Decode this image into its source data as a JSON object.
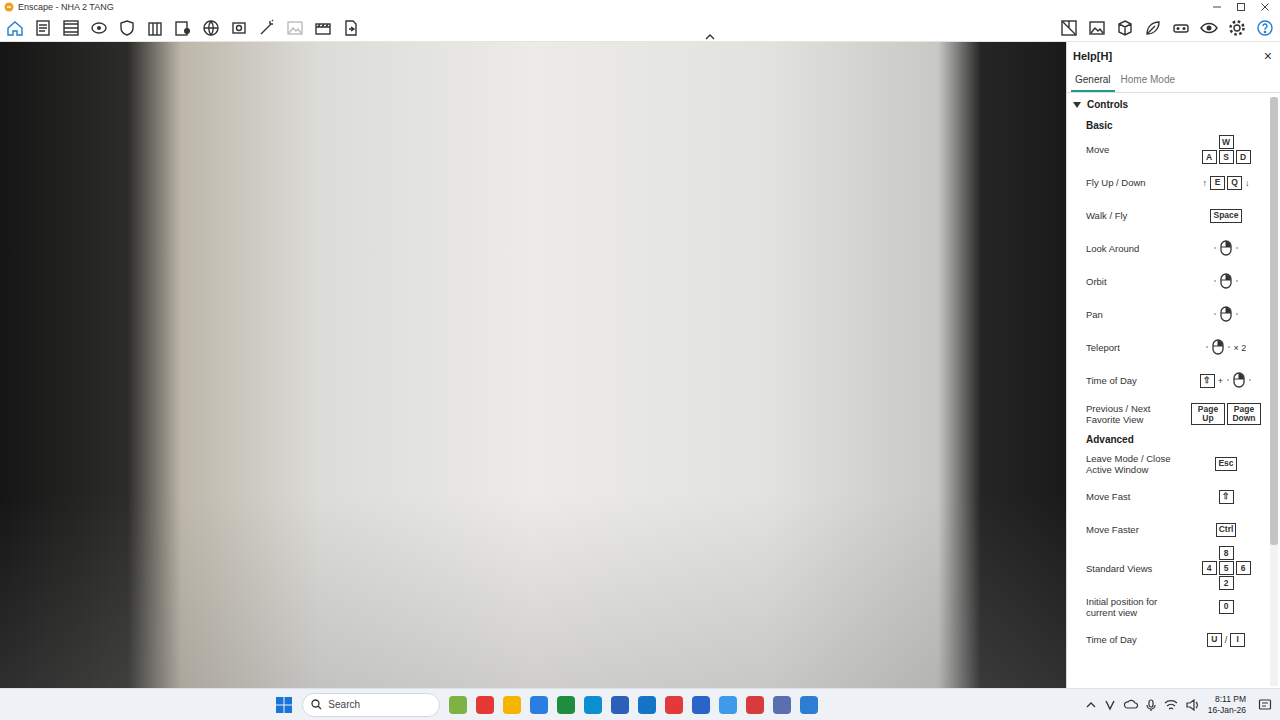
{
  "window": {
    "title": "Enscape - NHA 2 TANG"
  },
  "toolbar": {
    "left": [
      {
        "selected": true
      },
      {
        "selected": false
      },
      {
        "selected": false
      },
      {
        "selected": false
      },
      {
        "selected": false
      },
      {
        "selected": false
      },
      {
        "selected": false
      },
      {
        "selected": false
      },
      {
        "selected": false
      },
      {
        "selected": false
      },
      {
        "selected": false
      },
      {
        "selected": false
      },
      {
        "selected": false
      }
    ],
    "right": [
      {
        "selected": false
      },
      {
        "selected": false
      },
      {
        "selected": false
      },
      {
        "selected": false
      },
      {
        "selected": false
      },
      {
        "selected": false
      },
      {
        "selected": false
      },
      {
        "selected": true
      }
    ]
  },
  "help": {
    "title": "Help[H]",
    "close": "×",
    "tabs": [
      {
        "label": "General",
        "selected": true
      },
      {
        "label": "Home Mode",
        "selected": false
      }
    ],
    "section": {
      "label": "Controls",
      "expanded": true
    },
    "groups": [
      {
        "heading": "Basic",
        "rows": [
          {
            "label": "Move",
            "keys": [
              [
                {
                  "kind": "key",
                  "text": "W"
                }
              ],
              [
                {
                  "kind": "key",
                  "text": "A"
                },
                {
                  "kind": "key",
                  "text": "S"
                },
                {
                  "kind": "key",
                  "text": "D"
                }
              ]
            ]
          },
          {
            "label": "Fly Up / Down",
            "keys": [
              [
                {
                  "kind": "sep",
                  "text": "↑"
                },
                {
                  "kind": "key",
                  "text": "E"
                },
                {
                  "kind": "key",
                  "text": "Q"
                },
                {
                  "kind": "sep",
                  "text": "↓"
                }
              ]
            ]
          },
          {
            "label": "Walk / Fly",
            "keys": [
              [
                {
                  "kind": "key",
                  "text": "Space"
                }
              ]
            ]
          },
          {
            "label": "Look Around",
            "keys": [
              [
                {
                  "kind": "mouse"
                }
              ]
            ]
          },
          {
            "label": "Orbit",
            "keys": [
              [
                {
                  "kind": "mouse"
                }
              ]
            ]
          },
          {
            "label": "Pan",
            "keys": [
              [
                {
                  "kind": "mouse"
                }
              ]
            ]
          },
          {
            "label": "Teleport",
            "keys": [
              [
                {
                  "kind": "mouse"
                },
                {
                  "kind": "sep",
                  "text": "× 2"
                }
              ]
            ]
          },
          {
            "label": "Time of Day",
            "keys": [
              [
                {
                  "kind": "key",
                  "text": "⇧"
                },
                {
                  "kind": "sep",
                  "text": "+"
                },
                {
                  "kind": "mouse"
                }
              ]
            ]
          },
          {
            "label": "Previous / Next Favorite View",
            "keys": [
              [
                {
                  "kind": "wide",
                  "text": "Page Up"
                },
                {
                  "kind": "wide",
                  "text": "Page Down"
                }
              ]
            ]
          }
        ]
      },
      {
        "heading": "Advanced",
        "rows": [
          {
            "label": "Leave Mode / Close Active Window",
            "keys": [
              [
                {
                  "kind": "key",
                  "text": "Esc"
                }
              ]
            ]
          },
          {
            "label": "Move Fast",
            "keys": [
              [
                {
                  "kind": "key",
                  "text": "⇧"
                }
              ]
            ]
          },
          {
            "label": "Move Faster",
            "keys": [
              [
                {
                  "kind": "key",
                  "text": "Ctrl"
                }
              ]
            ]
          },
          {
            "label": "Standard Views",
            "keys": [
              [
                {
                  "kind": "key",
                  "text": "8"
                }
              ],
              [
                {
                  "kind": "key",
                  "text": "4"
                },
                {
                  "kind": "key",
                  "text": "5"
                },
                {
                  "kind": "key",
                  "text": "6"
                }
              ],
              [
                {
                  "kind": "key",
                  "text": "2"
                }
              ]
            ]
          },
          {
            "label": "Initial position for current view",
            "keys": [
              [
                {
                  "kind": "key",
                  "text": "0"
                }
              ]
            ]
          },
          {
            "label": "Time of Day",
            "keys": [
              [
                {
                  "kind": "key",
                  "text": "U"
                },
                {
                  "kind": "sep",
                  "text": "/"
                },
                {
                  "kind": "key",
                  "text": "I"
                }
              ]
            ]
          }
        ]
      }
    ],
    "scroll": {
      "level": 0.76
    }
  },
  "taskbar": {
    "search": {
      "placeholder": "Search"
    },
    "time": "8:11 PM",
    "date": "16-Jan-26"
  }
}
